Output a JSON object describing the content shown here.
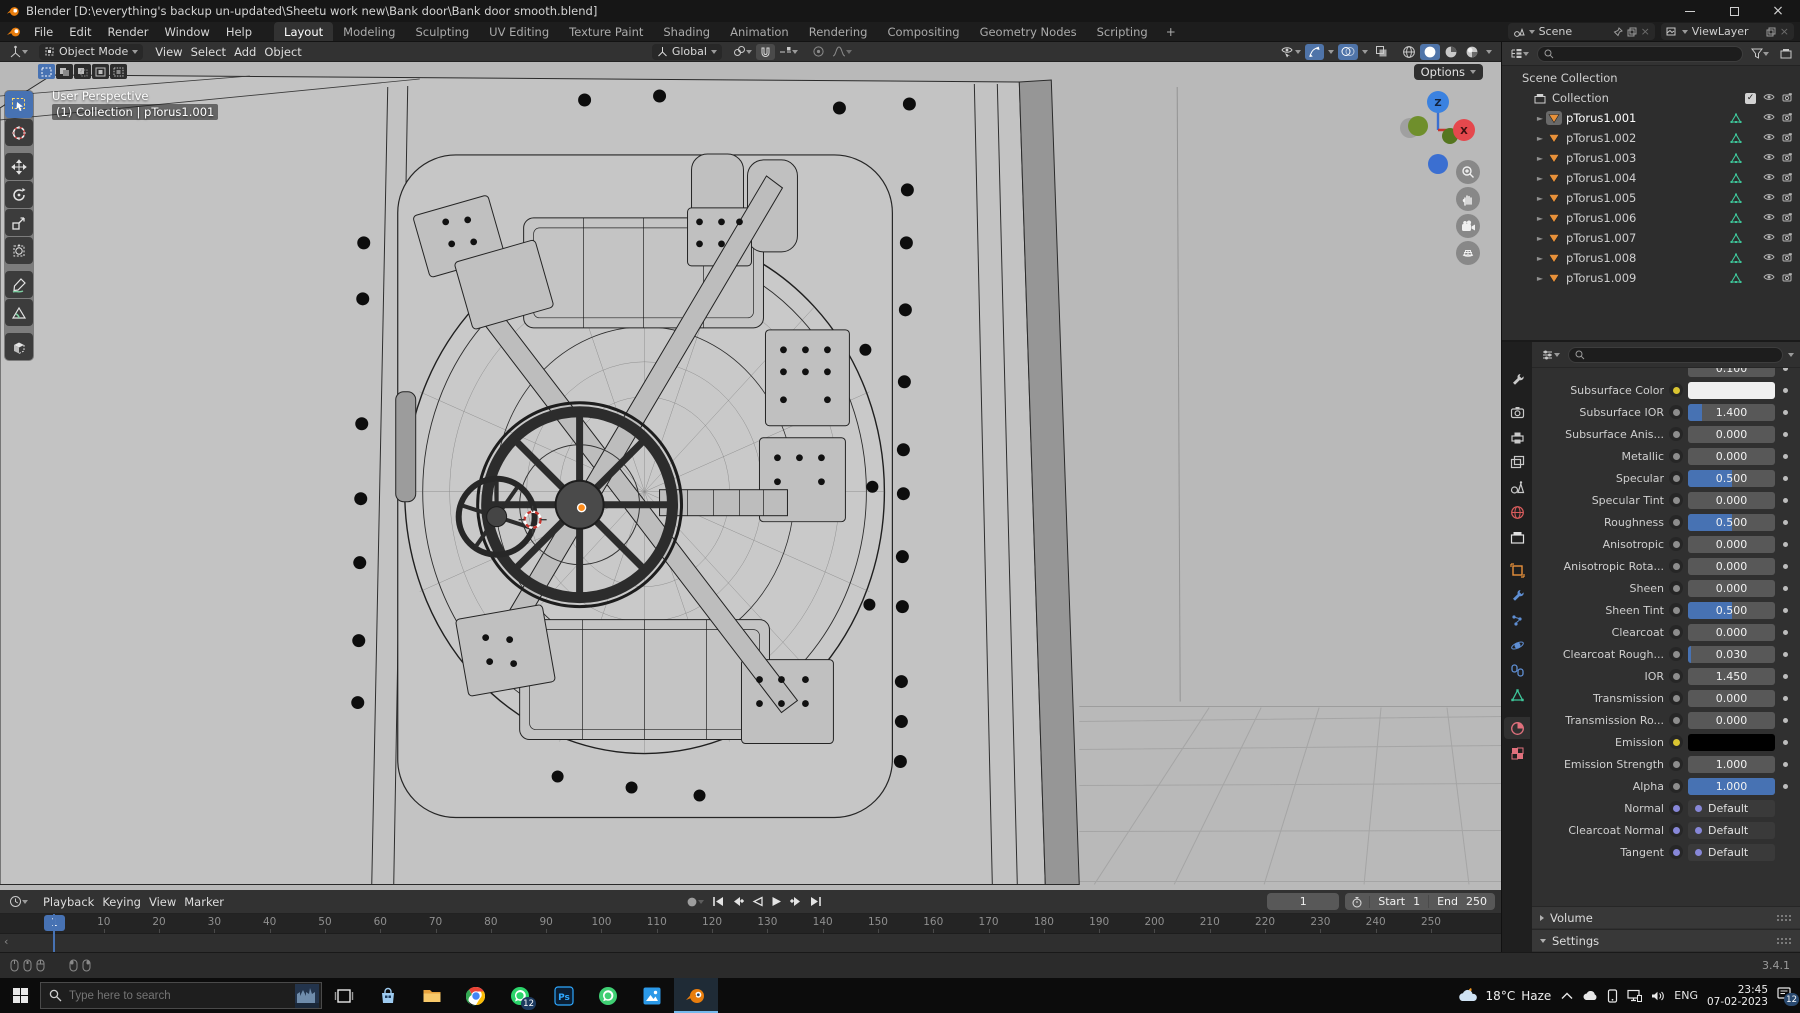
{
  "titlebar": {
    "title": "Blender [D:\\everything's backup un-updated\\Sheetu work new\\Bank door\\Bank door smooth.blend]"
  },
  "menubar": {
    "items": [
      "File",
      "Edit",
      "Render",
      "Window",
      "Help"
    ]
  },
  "workspaces": {
    "tabs": [
      {
        "label": "Layout",
        "active": true
      },
      {
        "label": "Modeling",
        "active": false
      },
      {
        "label": "Sculpting",
        "active": false
      },
      {
        "label": "UV Editing",
        "active": false
      },
      {
        "label": "Texture Paint",
        "active": false
      },
      {
        "label": "Shading",
        "active": false
      },
      {
        "label": "Animation",
        "active": false
      },
      {
        "label": "Rendering",
        "active": false
      },
      {
        "label": "Compositing",
        "active": false
      },
      {
        "label": "Geometry Nodes",
        "active": false
      },
      {
        "label": "Scripting",
        "active": false
      }
    ],
    "add_label": "+"
  },
  "scene_widget": {
    "label": "Scene"
  },
  "viewlayer_widget": {
    "label": "ViewLayer"
  },
  "vp_header": {
    "mode": "Object Mode",
    "menus": [
      "View",
      "Select",
      "Add",
      "Object"
    ],
    "orientation": "Global",
    "options_label": "Options"
  },
  "toolbar": {
    "tools": [
      "select-box",
      "cursor",
      "move",
      "rotate",
      "scale",
      "transform",
      "annotate",
      "measure",
      "add-cube"
    ],
    "active": "select-box"
  },
  "viewport": {
    "overlay_line1": "User Perspective",
    "overlay_line2": "(1) Collection | pTorus1.001",
    "gizmo_z": "Z",
    "gizmo_x": "X"
  },
  "outliner": {
    "rows": [
      {
        "name": "Scene Collection",
        "kind": "scene",
        "depth": 0
      },
      {
        "name": "Collection",
        "kind": "collection",
        "depth": 1
      },
      {
        "name": "pTorus1.001",
        "kind": "mesh",
        "depth": 2,
        "active": true
      },
      {
        "name": "pTorus1.002",
        "kind": "mesh",
        "depth": 2
      },
      {
        "name": "pTorus1.003",
        "kind": "mesh",
        "depth": 2
      },
      {
        "name": "pTorus1.004",
        "kind": "mesh",
        "depth": 2
      },
      {
        "name": "pTorus1.005",
        "kind": "mesh",
        "depth": 2
      },
      {
        "name": "pTorus1.006",
        "kind": "mesh",
        "depth": 2
      },
      {
        "name": "pTorus1.007",
        "kind": "mesh",
        "depth": 2
      },
      {
        "name": "pTorus1.008",
        "kind": "mesh",
        "depth": 2
      },
      {
        "name": "pTorus1.009",
        "kind": "mesh",
        "depth": 2
      }
    ]
  },
  "properties": {
    "tabs": [
      {
        "id": "tool",
        "color": "#c9c9c9"
      },
      {
        "id": "render",
        "color": "#c9c9c9"
      },
      {
        "id": "output",
        "color": "#c9c9c9"
      },
      {
        "id": "view-layer",
        "color": "#c9c9c9"
      },
      {
        "id": "scene",
        "color": "#c9c9c9"
      },
      {
        "id": "world",
        "color": "#d95c5c"
      },
      {
        "id": "collection",
        "color": "#e0e0e0"
      },
      {
        "id": "object",
        "color": "#e8913a"
      },
      {
        "id": "modifiers",
        "color": "#5f8fd4"
      },
      {
        "id": "particles",
        "color": "#5f8fd4"
      },
      {
        "id": "physics",
        "color": "#5f8fd4"
      },
      {
        "id": "constraints",
        "color": "#5f8fd4"
      },
      {
        "id": "data",
        "color": "#3ec69a"
      },
      {
        "id": "material",
        "color": "#e0707c",
        "active": true
      },
      {
        "id": "texture",
        "color": "#e0707c"
      }
    ],
    "rows": [
      {
        "type": "partial",
        "value": "0.100",
        "decorator": true
      },
      {
        "label": "Subsurface Color",
        "type": "color",
        "swatch": "#f0f0f0",
        "socket": "yellow",
        "decorator": true
      },
      {
        "label": "Subsurface IOR",
        "type": "slider",
        "value": "1.400",
        "fill": 0.16,
        "socket": "grey",
        "decorator": true
      },
      {
        "label": "Subsurface Anis...",
        "type": "slider",
        "value": "0.000",
        "fill": 0,
        "socket": "grey",
        "decorator": true
      },
      {
        "label": "Metallic",
        "type": "slider",
        "value": "0.000",
        "fill": 0,
        "socket": "grey",
        "decorator": true
      },
      {
        "label": "Specular",
        "type": "slider",
        "value": "0.500",
        "fill": 0.5,
        "socket": "grey",
        "decorator": true
      },
      {
        "label": "Specular Tint",
        "type": "slider",
        "value": "0.000",
        "fill": 0,
        "socket": "grey",
        "decorator": true
      },
      {
        "label": "Roughness",
        "type": "slider",
        "value": "0.500",
        "fill": 0.5,
        "socket": "grey",
        "decorator": true
      },
      {
        "label": "Anisotropic",
        "type": "slider",
        "value": "0.000",
        "fill": 0,
        "socket": "grey",
        "decorator": true
      },
      {
        "label": "Anisotropic Rota...",
        "type": "slider",
        "value": "0.000",
        "fill": 0,
        "socket": "grey",
        "decorator": true
      },
      {
        "label": "Sheen",
        "type": "slider",
        "value": "0.000",
        "fill": 0,
        "socket": "grey",
        "decorator": true
      },
      {
        "label": "Sheen Tint",
        "type": "slider",
        "value": "0.500",
        "fill": 0.5,
        "socket": "grey",
        "decorator": true
      },
      {
        "label": "Clearcoat",
        "type": "slider",
        "value": "0.000",
        "fill": 0,
        "socket": "grey",
        "decorator": true
      },
      {
        "label": "Clearcoat Rough...",
        "type": "slider",
        "value": "0.030",
        "fill": 0.04,
        "socket": "grey",
        "decorator": true
      },
      {
        "label": "IOR",
        "type": "slider",
        "value": "1.450",
        "fill": 0,
        "socket": "grey",
        "decorator": true
      },
      {
        "label": "Transmission",
        "type": "slider",
        "value": "0.000",
        "fill": 0,
        "socket": "grey",
        "decorator": true
      },
      {
        "label": "Transmission Ro...",
        "type": "slider",
        "value": "0.000",
        "fill": 0,
        "socket": "grey",
        "decorator": true
      },
      {
        "label": "Emission",
        "type": "color",
        "swatch": "#000000",
        "socket": "yellow",
        "decorator": true
      },
      {
        "label": "Emission Strength",
        "type": "slider",
        "value": "1.000",
        "fill": 0,
        "socket": "grey",
        "decorator": true
      },
      {
        "label": "Alpha",
        "type": "slider",
        "value": "1.000",
        "fill": 1,
        "socket": "grey",
        "decorator": true
      },
      {
        "label": "Normal",
        "type": "link",
        "value": "Default",
        "socket": "purple",
        "decorator": false
      },
      {
        "label": "Clearcoat Normal",
        "type": "link",
        "value": "Default",
        "socket": "purple",
        "decorator": false
      },
      {
        "label": "Tangent",
        "type": "link",
        "value": "Default",
        "socket": "purple",
        "decorator": false
      }
    ],
    "sections": [
      {
        "label": "Volume",
        "expanded": false
      },
      {
        "label": "Settings",
        "expanded": true
      }
    ]
  },
  "timeline": {
    "menus": [
      "Playback",
      "Keying",
      "View",
      "Marker"
    ],
    "current_frame": "1",
    "start_label": "Start",
    "start": "1",
    "end_label": "End",
    "end": "250",
    "ruler": [
      10,
      20,
      30,
      40,
      50,
      60,
      70,
      80,
      90,
      100,
      110,
      120,
      130,
      140,
      150,
      160,
      170,
      180,
      190,
      200,
      210,
      220,
      230,
      240,
      250
    ]
  },
  "statusbar": {
    "version": "3.4.1"
  },
  "taskbar": {
    "search_placeholder": "Type here to search",
    "apps": [
      {
        "id": "task-view"
      },
      {
        "id": "store"
      },
      {
        "id": "file-explorer"
      },
      {
        "id": "chrome"
      },
      {
        "id": "whatsapp",
        "badge": "12"
      },
      {
        "id": "photoshop",
        "text": "Ps"
      },
      {
        "id": "whatsapp2"
      },
      {
        "id": "photos"
      },
      {
        "id": "blender",
        "active": true
      }
    ],
    "weather_temp": "18°C",
    "weather_desc": "Haze",
    "lang": "ENG",
    "time": "23:45",
    "date": "07-02-2023",
    "tray_badge": "12"
  }
}
